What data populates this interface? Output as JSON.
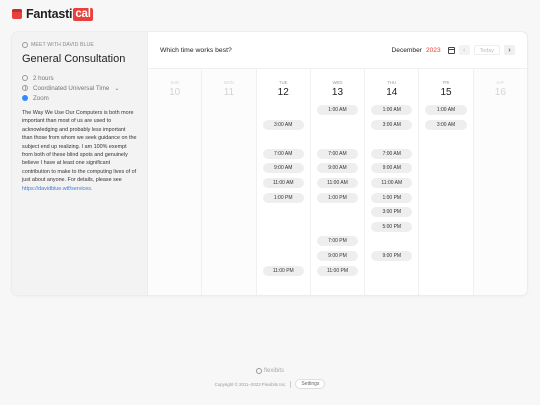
{
  "brand": {
    "name_main": "Fantasti",
    "name_cal": "cal"
  },
  "left": {
    "meet_with": "MEET WITH DAVID BLUE",
    "title": "General Consultation",
    "duration": "2 hours",
    "timezone": "Coordinated Universal Time",
    "location": "Zoom",
    "description": "The Way We Use Our Computers is both more important than most of us are used to acknowledging and probably less important than those from whom we seek guidance on the subject end up realizing. I am 100% exempt from both of these blind spots and genuinely believe I have at least one significant contribution to make to the computing lives of of just about anyone. For details, please see",
    "link_text": "https://davidblue.wtf/services."
  },
  "header": {
    "question": "Which time works best?",
    "month": "December",
    "year": "2023",
    "today_label": "Today",
    "prev_icon": "‹",
    "next_icon": "›"
  },
  "days": [
    {
      "dow": "SUN",
      "num": "10",
      "disabled": true,
      "slots": []
    },
    {
      "dow": "MON",
      "num": "11",
      "disabled": true,
      "slots": []
    },
    {
      "dow": "TUE",
      "num": "12",
      "disabled": false,
      "slots": [
        {
          "row": 1,
          "label": "3:00 AM"
        },
        {
          "row": 3,
          "label": "7:00 AM"
        },
        {
          "row": 4,
          "label": "9:00 AM"
        },
        {
          "row": 5,
          "label": "11:00 AM"
        },
        {
          "row": 6,
          "label": "1:00 PM"
        },
        {
          "row": 11,
          "label": "11:00 PM"
        }
      ]
    },
    {
      "dow": "WED",
      "num": "13",
      "disabled": false,
      "slots": [
        {
          "row": 0,
          "label": "1:00 AM"
        },
        {
          "row": 3,
          "label": "7:00 AM"
        },
        {
          "row": 4,
          "label": "9:00 AM"
        },
        {
          "row": 5,
          "label": "11:00 AM"
        },
        {
          "row": 6,
          "label": "1:00 PM"
        },
        {
          "row": 9,
          "label": "7:00 PM"
        },
        {
          "row": 10,
          "label": "9:00 PM"
        },
        {
          "row": 11,
          "label": "11:00 PM"
        }
      ]
    },
    {
      "dow": "THU",
      "num": "14",
      "disabled": false,
      "slots": [
        {
          "row": 0,
          "label": "1:00 AM"
        },
        {
          "row": 1,
          "label": "3:00 AM"
        },
        {
          "row": 3,
          "label": "7:00 AM"
        },
        {
          "row": 4,
          "label": "9:00 AM"
        },
        {
          "row": 5,
          "label": "11:00 AM"
        },
        {
          "row": 6,
          "label": "1:00 PM"
        },
        {
          "row": 7,
          "label": "3:00 PM"
        },
        {
          "row": 8,
          "label": "5:00 PM"
        },
        {
          "row": 10,
          "label": "9:00 PM"
        }
      ]
    },
    {
      "dow": "FRI",
      "num": "15",
      "disabled": false,
      "slots": [
        {
          "row": 0,
          "label": "1:00 AM"
        },
        {
          "row": 1,
          "label": "3:00 AM"
        }
      ]
    },
    {
      "dow": "SAT",
      "num": "16",
      "disabled": true,
      "slots": []
    }
  ],
  "footer": {
    "flexibits": "flexibits",
    "copyright": "Copyright © 2011–2023 Flexibits Inc.",
    "settings_label": "Settings"
  },
  "colors": {
    "accent": "#e8403c",
    "link": "#3a7bd5",
    "zoom": "#2d8cff",
    "slot_bg": "#eeeeee"
  },
  "icons": [
    "calendar-icon",
    "clock-icon",
    "globe-icon",
    "zoom-icon",
    "person-icon"
  ]
}
